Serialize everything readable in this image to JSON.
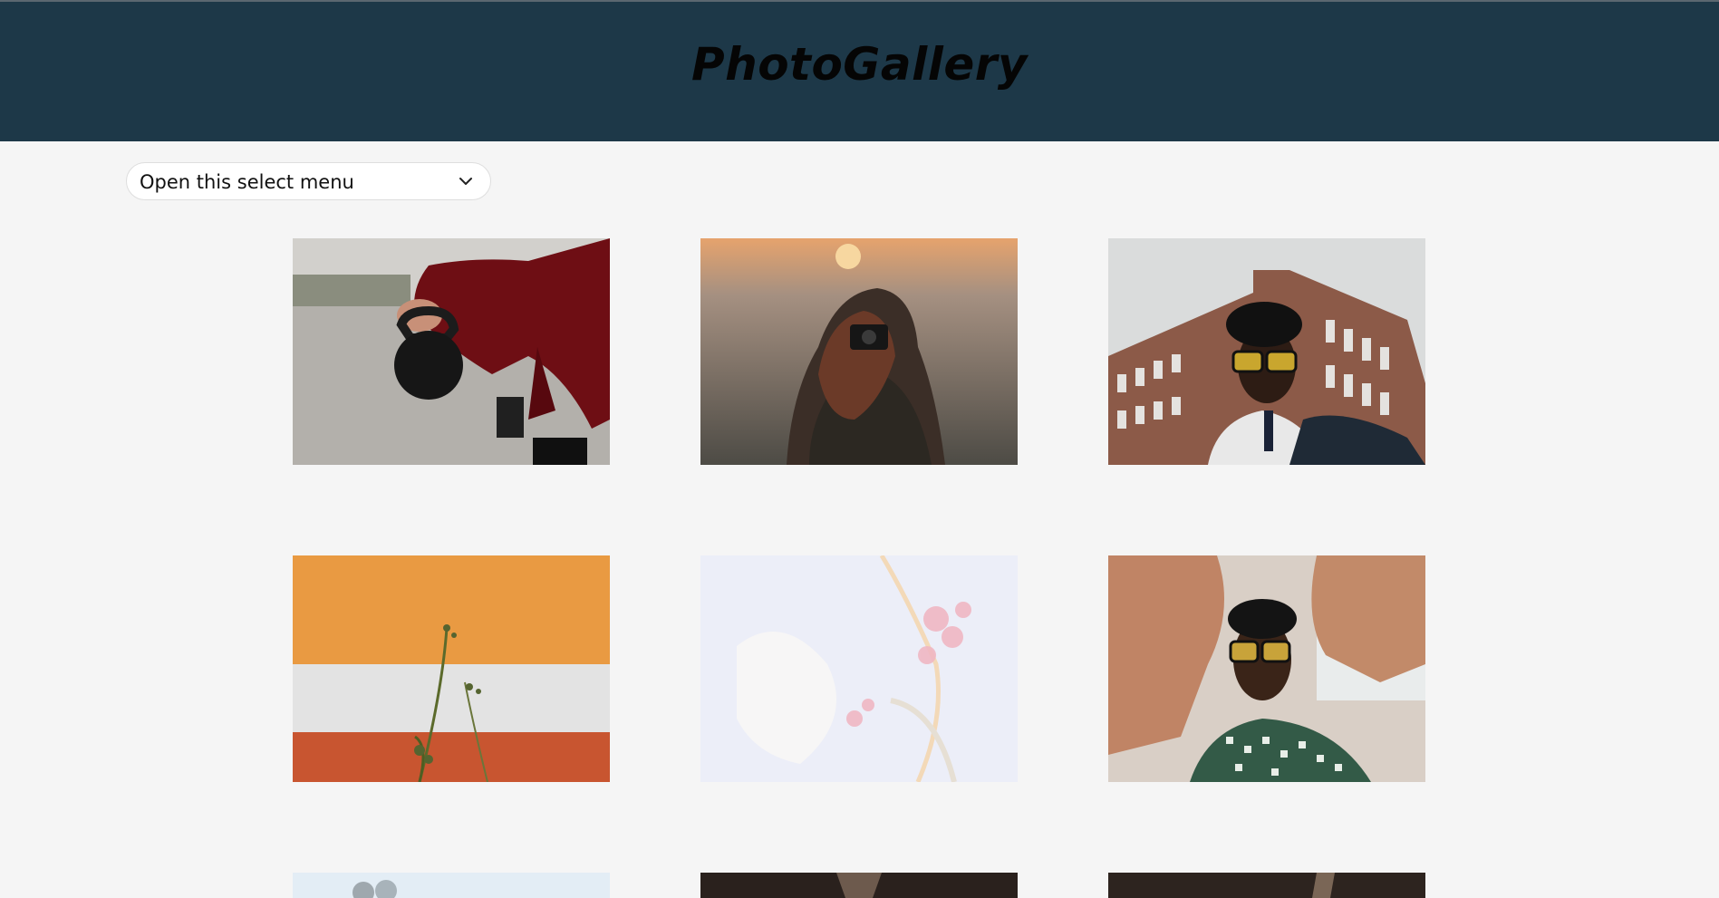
{
  "app": {
    "brand_title": "PhotoGallery"
  },
  "filter": {
    "select_value": "Open this select menu"
  },
  "gallery": {
    "images": [
      {
        "subject": "person crouching holding kettlebell"
      },
      {
        "subject": "woman with camera at sunset"
      },
      {
        "subject": "man in yellow glasses before brick building"
      },
      {
        "subject": "orange white red wall with plant"
      },
      {
        "subject": "white textured paint with pink"
      },
      {
        "subject": "man framing face with hands"
      },
      {
        "subject": "skates partial"
      },
      {
        "subject": "dark photo partial"
      },
      {
        "subject": "dark photo partial"
      }
    ]
  },
  "colors": {
    "header_bg": "#1d3848",
    "page_bg": "#f5f5f5"
  }
}
